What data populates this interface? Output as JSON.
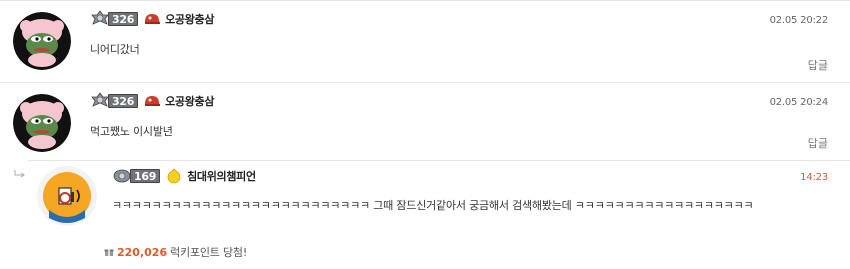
{
  "comments": [
    {
      "level": "326",
      "nickname": "오공왕충삼",
      "time": "02.05 20:22",
      "text": "니어디갔너",
      "reply_label": "답글"
    },
    {
      "level": "326",
      "nickname": "오공왕충삼",
      "time": "02.05 20:24",
      "text": "먹고쨌노 이시발년",
      "reply_label": "답글"
    }
  ],
  "reply": {
    "level": "169",
    "nickname": "침대위의챔피언",
    "time": "14:23",
    "text": "ㅋㅋㅋㅋㅋㅋㅋㅋㅋㅋㅋㅋㅋㅋㅋㅋㅋㅋㅋㅋㅋㅋㅋㅋㅋㅋ 그때 잠드신거같아서 궁금해서 검색해봤는데 ㅋㅋㅋㅋㅋㅋㅋㅋㅋㅋㅋㅋㅋㅋㅋㅋㅋㅋ",
    "lucky_points": "220,026",
    "lucky_text": "럭키포인트 당첨!"
  },
  "icons": {
    "rank": "rank-emblem-icon",
    "badge": "cap-badge-icon",
    "reply_arrow": "reply-arrow-icon",
    "gift": "gift-icon"
  },
  "colors": {
    "time_highlight": "#e05a2a",
    "points": "#e05a2a"
  }
}
